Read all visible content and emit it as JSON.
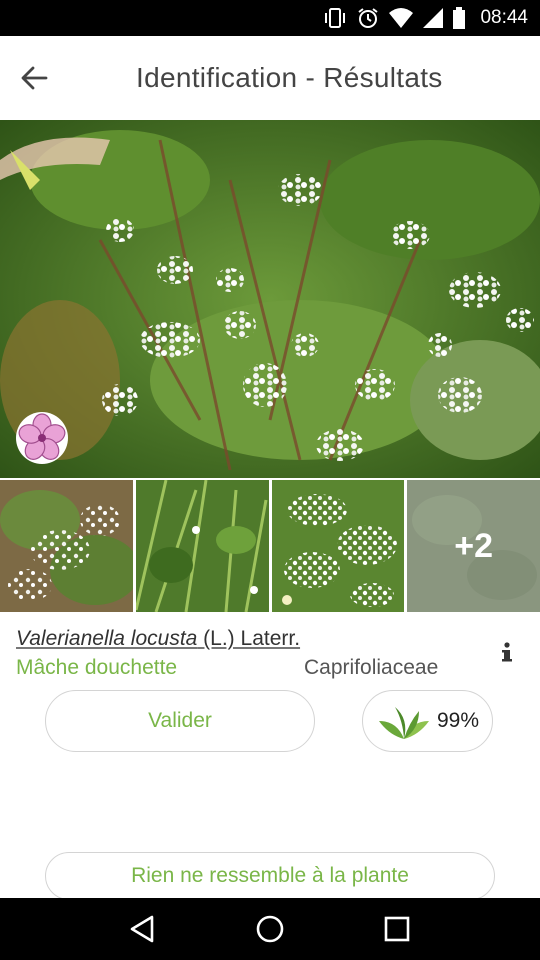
{
  "status_bar": {
    "time": "08:44",
    "icons": [
      "vibrate-icon",
      "alarm-icon",
      "wifi-icon",
      "signal-icon",
      "battery-icon"
    ]
  },
  "header": {
    "title": "Identification - Résultats",
    "back_icon": "arrow-left-icon"
  },
  "main_image": {
    "badge_icon": "flower-icon"
  },
  "thumbnails": {
    "more_count": "+2"
  },
  "result": {
    "genus_species": "Valerianella locusta",
    "author": " (L.) Laterr.",
    "common_name": "Mâche douchette",
    "family": "Caprifoliaceae",
    "validate_label": "Valider",
    "score": "99%",
    "score_icon": "leaves-icon",
    "info_icon": "info-icon"
  },
  "footer": {
    "nothing_label": "Rien ne ressemble à la plante"
  },
  "nav": [
    "back-triangle-icon",
    "home-circle-icon",
    "recents-square-icon"
  ],
  "colors": {
    "accent_green": "#7ab648",
    "border_gray": "#d4d4d4",
    "flower_pink": "#e9a2d6"
  }
}
